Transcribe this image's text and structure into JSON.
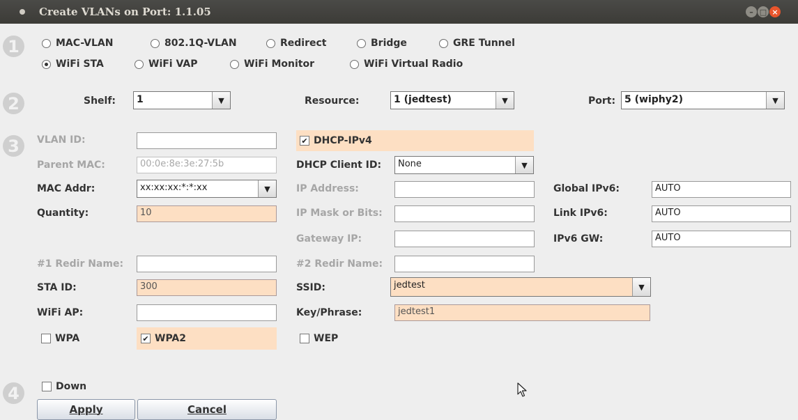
{
  "window": {
    "title": "Create VLANs on Port: 1.1.05"
  },
  "steps": [
    "1",
    "2",
    "3",
    "4"
  ],
  "type_options": [
    {
      "label": "MAC-VLAN",
      "selected": false
    },
    {
      "label": "802.1Q-VLAN",
      "selected": false
    },
    {
      "label": "Redirect",
      "selected": false
    },
    {
      "label": "Bridge",
      "selected": false
    },
    {
      "label": "GRE Tunnel",
      "selected": false
    },
    {
      "label": "WiFi STA",
      "selected": true
    },
    {
      "label": "WiFi VAP",
      "selected": false
    },
    {
      "label": "WiFi Monitor",
      "selected": false
    },
    {
      "label": "WiFi Virtual Radio",
      "selected": false
    }
  ],
  "location": {
    "shelf_label": "Shelf:",
    "shelf_value": "1",
    "resource_label": "Resource:",
    "resource_value": "1 (jedtest)",
    "port_label": "Port:",
    "port_value": "5 (wiphy2)"
  },
  "config": {
    "vlan_id_label": "VLAN ID:",
    "vlan_id_value": "",
    "parent_mac_label": "Parent MAC:",
    "parent_mac_value": "00:0e:8e:3e:27:5b",
    "mac_addr_label": "MAC Addr:",
    "mac_addr_value": "xx:xx:xx:*:*:xx",
    "quantity_label": "Quantity:",
    "quantity_value": "10",
    "redir1_label": "#1 Redir Name:",
    "redir1_value": "",
    "sta_id_label": "STA ID:",
    "sta_id_value": "300",
    "wifi_ap_label": "WiFi AP:",
    "wifi_ap_value": "",
    "wpa_label": "WPA",
    "wpa_checked": false,
    "wpa2_label": "WPA2",
    "wpa2_checked": true,
    "dhcp_ipv4_label": "DHCP-IPv4",
    "dhcp_ipv4_checked": true,
    "dhcp_client_id_label": "DHCP Client ID:",
    "dhcp_client_id_value": "None",
    "ip_address_label": "IP Address:",
    "ip_address_value": "",
    "ip_mask_label": "IP Mask or Bits:",
    "ip_mask_value": "",
    "gateway_ip_label": "Gateway IP:",
    "gateway_ip_value": "",
    "redir2_label": "#2 Redir Name:",
    "redir2_value": "",
    "ssid_label": "SSID:",
    "ssid_value": "jedtest",
    "key_label": "Key/Phrase:",
    "key_value": "jedtest1",
    "wep_label": "WEP",
    "wep_checked": false,
    "global_ipv6_label": "Global IPv6:",
    "global_ipv6_value": "AUTO",
    "link_ipv6_label": "Link IPv6:",
    "link_ipv6_value": "AUTO",
    "ipv6_gw_label": "IPv6 GW:",
    "ipv6_gw_value": "AUTO"
  },
  "footer": {
    "down_label": "Down",
    "down_checked": false,
    "apply_label": "Apply",
    "cancel_label": "Cancel"
  },
  "icons": {
    "dropdown": "chevron-down-icon",
    "checkmark": "✔",
    "window_buttons": [
      "minimize-icon",
      "maximize-icon",
      "close-icon"
    ]
  },
  "colors": {
    "highlight": "#fddfc3",
    "titlebar": "#3c3b37",
    "close": "#e9552c"
  }
}
